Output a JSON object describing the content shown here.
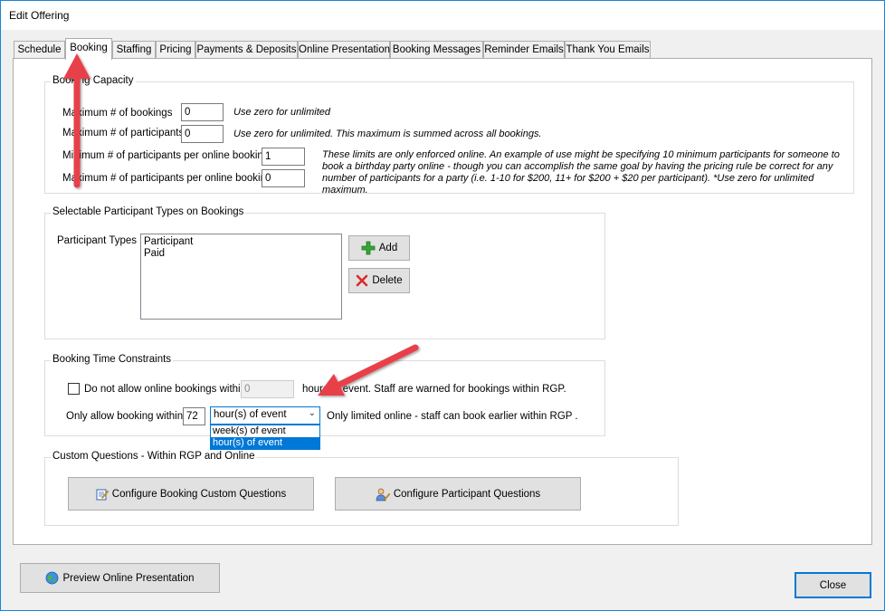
{
  "window": {
    "title": "Edit Offering"
  },
  "tabs": [
    {
      "label": "Schedule"
    },
    {
      "label": "Booking"
    },
    {
      "label": "Staffing"
    },
    {
      "label": "Pricing"
    },
    {
      "label": "Payments & Deposits"
    },
    {
      "label": "Online Presentation"
    },
    {
      "label": "Booking Messages"
    },
    {
      "label": "Reminder Emails"
    },
    {
      "label": "Thank You Emails"
    }
  ],
  "capacity": {
    "legend": "Booking Capacity",
    "max_bookings_label": "Maximum # of bookings",
    "max_bookings_value": "0",
    "max_bookings_hint": "Use zero for unlimited",
    "max_participants_label": "Maximum # of participants",
    "max_participants_value": "0",
    "max_participants_hint": "Use zero for unlimited.  This maximum is summed across all bookings.",
    "min_online_label": "Minimum # of participants per online booking",
    "min_online_value": "1",
    "max_online_label": "Maximum # of participants per online booking",
    "max_online_value": "0",
    "online_limits_hint": "These limits are only enforced online.  An example of use might be specifying 10 minimum participants for someone to book a birthday party online - though you can accomplish the same goal by having the pricing rule be correct for any number of participants for a party (i.e. 1-10 for $200, 11+ for $200 + $20 per participant).  *Use zero for unlimited maximum."
  },
  "participant_types": {
    "legend": "Selectable Participant Types on Bookings",
    "label": "Participant Types",
    "items": [
      "Participant",
      "Paid"
    ],
    "add_label": "Add",
    "delete_label": "Delete"
  },
  "time_constraints": {
    "legend": "Booking Time Constraints",
    "no_online_label": "Do not allow online bookings within",
    "no_online_value": "0",
    "no_online_suffix": "hours of event.   Staff are warned for bookings within RGP.",
    "only_within_label": "Only allow booking within",
    "only_within_value": "72",
    "unit_selected": "hour(s) of event",
    "unit_options": [
      "week(s) of event",
      "hour(s) of event"
    ],
    "only_within_suffix": "Only limited online - staff can book earlier within RGP ."
  },
  "custom_questions": {
    "legend": "Custom Questions - Within RGP and Online",
    "booking_questions_label": "Configure Booking Custom Questions",
    "participant_questions_label": "Configure Participant Questions"
  },
  "footer": {
    "preview_label": "Preview Online Presentation",
    "close_label": "Close"
  },
  "colors": {
    "accent": "#0078d7",
    "annotation_arrow": "#e8404a"
  }
}
